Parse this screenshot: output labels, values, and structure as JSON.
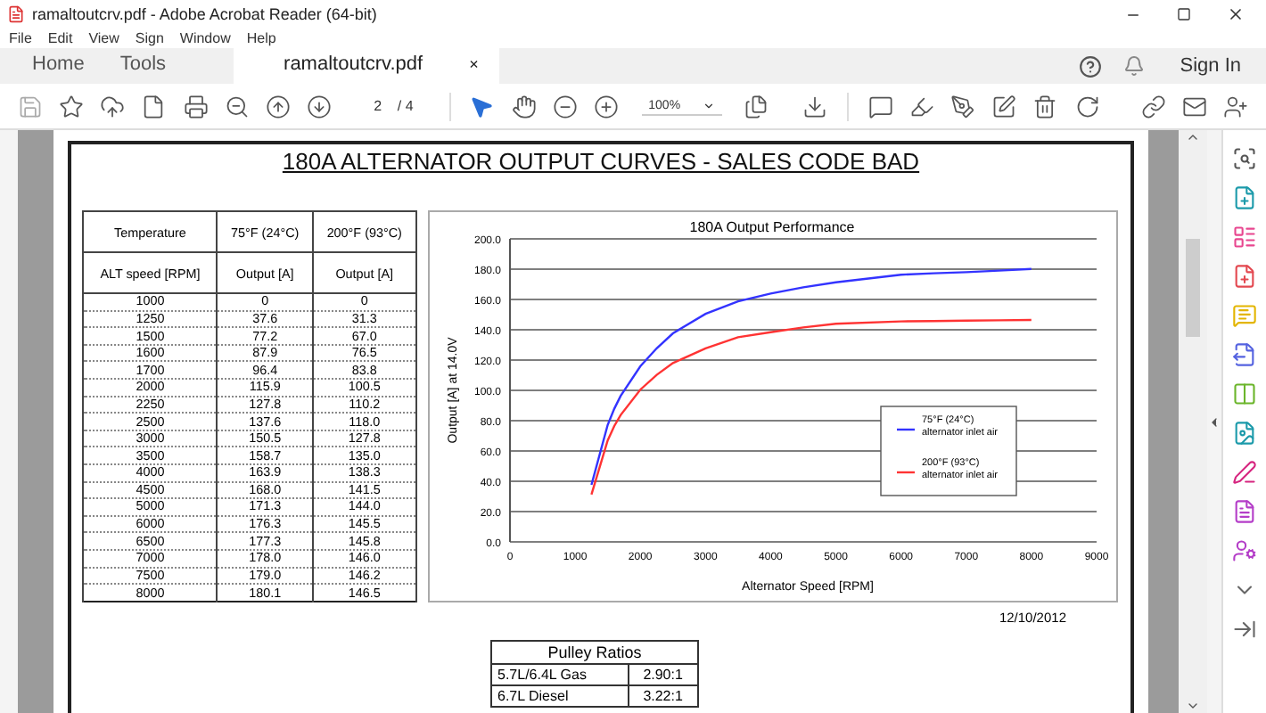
{
  "window": {
    "title": "ramaltoutcrv.pdf - Adobe Acrobat Reader (64-bit)"
  },
  "menu": [
    "File",
    "Edit",
    "View",
    "Sign",
    "Window",
    "Help"
  ],
  "tabs": [
    {
      "label": "Home",
      "selected": false,
      "kind": "nav"
    },
    {
      "label": "Tools",
      "selected": false,
      "kind": "nav"
    },
    {
      "label": "ramaltoutcrv.pdf",
      "selected": true,
      "kind": "document",
      "close": "×"
    }
  ],
  "sign_in": "Sign In",
  "toolbar": {
    "page": "2",
    "page_total": "/ 4",
    "zoom": "100%"
  },
  "document": {
    "title": "180A ALTERNATOR OUTPUT CURVES - SALES CODE BAD",
    "table": {
      "header": [
        "Temperature",
        "75°F (24°C)",
        "200°F (93°C)"
      ],
      "subheader": [
        "ALT speed [RPM]",
        "Output [A]",
        "Output [A]"
      ],
      "rows": [
        [
          "1000",
          "0",
          "0"
        ],
        [
          "1250",
          "37.6",
          "31.3"
        ],
        [
          "1500",
          "77.2",
          "67.0"
        ],
        [
          "1600",
          "87.9",
          "76.5"
        ],
        [
          "1700",
          "96.4",
          "83.8"
        ],
        [
          "2000",
          "115.9",
          "100.5"
        ],
        [
          "2250",
          "127.8",
          "110.2"
        ],
        [
          "2500",
          "137.6",
          "118.0"
        ],
        [
          "3000",
          "150.5",
          "127.8"
        ],
        [
          "3500",
          "158.7",
          "135.0"
        ],
        [
          "4000",
          "163.9",
          "138.3"
        ],
        [
          "4500",
          "168.0",
          "141.5"
        ],
        [
          "5000",
          "171.3",
          "144.0"
        ],
        [
          "6000",
          "176.3",
          "145.5"
        ],
        [
          "6500",
          "177.3",
          "145.8"
        ],
        [
          "7000",
          "178.0",
          "146.0"
        ],
        [
          "7500",
          "179.0",
          "146.2"
        ],
        [
          "8000",
          "180.1",
          "146.5"
        ]
      ]
    },
    "chart_data": {
      "type": "line",
      "title": "180A Output Performance",
      "xlabel": "Alternator Speed [RPM]",
      "ylabel": "Output [A] at 14.0V",
      "x": [
        1250,
        1500,
        1600,
        1700,
        2000,
        2250,
        2500,
        3000,
        3500,
        4000,
        4500,
        5000,
        6000,
        6500,
        7000,
        7500,
        8000
      ],
      "series": [
        {
          "name": "75°F  (24°C) alternator inlet air",
          "color": "#3333ff",
          "values": [
            37.6,
            77.2,
            87.9,
            96.4,
            115.9,
            127.8,
            137.6,
            150.5,
            158.7,
            163.9,
            168.0,
            171.3,
            176.3,
            177.3,
            178.0,
            179.0,
            180.1
          ]
        },
        {
          "name": "200°F (93°C) alternator inlet air",
          "color": "#ff3333",
          "values": [
            31.3,
            67.0,
            76.5,
            83.8,
            100.5,
            110.2,
            118.0,
            127.8,
            135.0,
            138.3,
            141.5,
            144.0,
            145.5,
            145.8,
            146.0,
            146.2,
            146.5
          ]
        }
      ],
      "xlim": [
        0,
        9000
      ],
      "ylim": [
        0,
        200
      ],
      "grid": true,
      "legend": true,
      "xticks": [
        0,
        1000,
        2000,
        3000,
        4000,
        5000,
        6000,
        7000,
        8000,
        9000
      ],
      "yticks": [
        {
          "value": 0,
          "label": "0.0"
        },
        {
          "value": 20,
          "label": "20.0"
        },
        {
          "value": 40,
          "label": "40.0"
        },
        {
          "value": 60,
          "label": "60.0"
        },
        {
          "value": 80,
          "label": "80.0"
        },
        {
          "value": 100,
          "label": "100.0"
        },
        {
          "value": 120,
          "label": "120.0"
        },
        {
          "value": 140,
          "label": "140.0"
        },
        {
          "value": 160,
          "label": "160.0"
        },
        {
          "value": 180,
          "label": "180.0"
        },
        {
          "value": 200,
          "label": "200.0"
        }
      ]
    },
    "date": "12/10/2012",
    "pulley": {
      "title": "Pulley Ratios",
      "rows": [
        [
          "5.7L/6.4L Gas",
          "2.90:1"
        ],
        [
          "6.7L Diesel",
          "3.22:1"
        ]
      ]
    }
  }
}
